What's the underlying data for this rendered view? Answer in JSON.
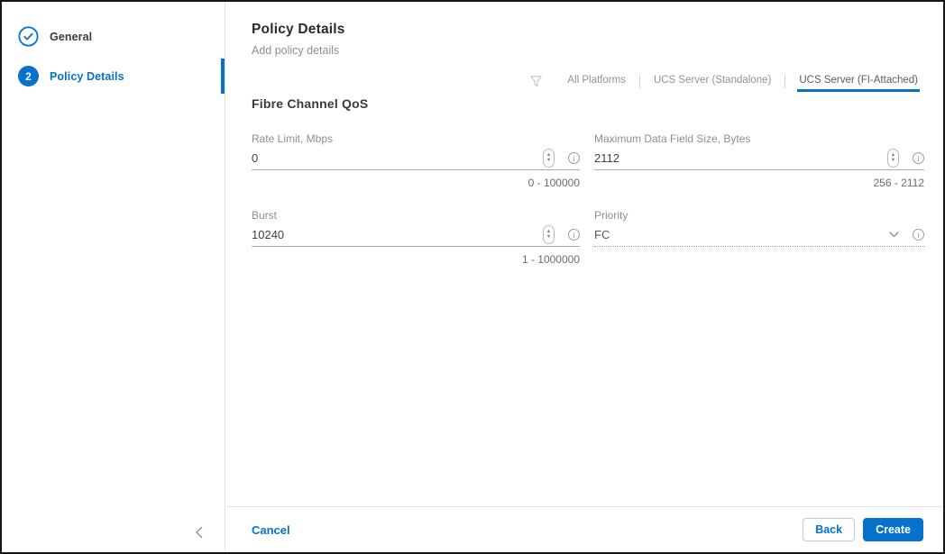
{
  "colors": {
    "accent": "#0672CB",
    "text_dark": "#3b3b3b",
    "text_muted": "#8f8f8f"
  },
  "sidebar": {
    "steps": [
      {
        "label": "General",
        "state": "completed"
      },
      {
        "number": "2",
        "label": "Policy Details",
        "state": "active"
      }
    ],
    "collapse_icon": "❮"
  },
  "header": {
    "title": "Policy Details",
    "subtitle": "Add policy details"
  },
  "platform_filter": {
    "filter_icon": "funnel",
    "tabs": [
      {
        "label": "All Platforms",
        "selected": false
      },
      {
        "label": "UCS Server (Standalone)",
        "selected": false
      },
      {
        "label": "UCS Server (FI-Attached)",
        "selected": true
      }
    ]
  },
  "section": {
    "title": "Fibre Channel QoS"
  },
  "fields": {
    "rate_limit": {
      "label": "Rate Limit, Mbps",
      "value": "0",
      "range": "0 - 100000"
    },
    "max_data_field_size": {
      "label": "Maximum Data Field Size, Bytes",
      "value": "2112",
      "range": "256 - 2112"
    },
    "burst": {
      "label": "Burst",
      "value": "10240",
      "range": "1 - 1000000"
    },
    "priority": {
      "label": "Priority",
      "value": "FC"
    }
  },
  "icons": {
    "spinner_up": "▲",
    "spinner_down": "▼",
    "info": "i"
  },
  "footer": {
    "cancel_label": "Cancel",
    "back_label": "Back",
    "create_label": "Create"
  }
}
